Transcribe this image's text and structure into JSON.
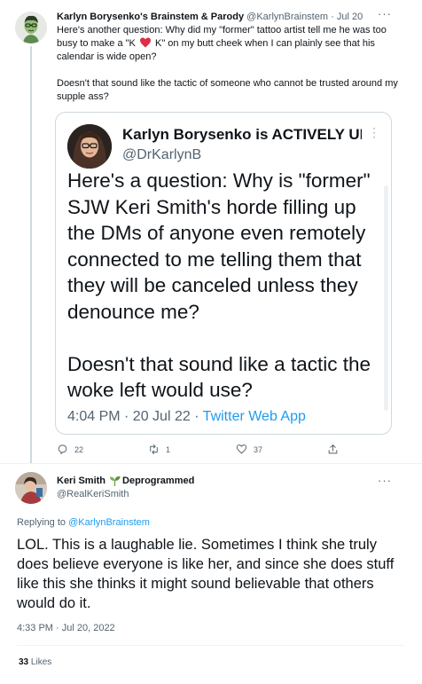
{
  "tweet": {
    "author_name": "Karlyn Borysenko's Brainstem & Parody",
    "author_handle": "@KarlynBrainstem",
    "separator": "·",
    "date": "Jul 20",
    "text_line1_before_heart": "Here's another question: Why did my \"former\" tattoo artist tell me he was too busy to make a \"K ",
    "text_line1_after_heart": " K\" on my butt cheek when I can plainly see that his calendar is wide open?",
    "text_paragraph2": "Doesn't that sound like the tactic of someone who cannot be trusted around my supple ass?",
    "heart_icon": "red-heart-emoji",
    "stats": {
      "replies": "22",
      "retweets": "1",
      "likes": "37"
    }
  },
  "quoted_tweet": {
    "author_name": "Karlyn Borysenko is ACTIVELY UN...",
    "author_handle": "@DrKarlynB",
    "paragraph1": "Here's a question: Why is \"former\" SJW Keri Smith's horde filling up the DMs of anyone even remotely connected to me telling them that they will be canceled unless they denounce me?",
    "paragraph2": "Doesn't that sound like a tactic the woke left would use?",
    "timestamp": "4:04 PM · 20 Jul 22 · ",
    "source": "Twitter Web App"
  },
  "reply": {
    "author_name": "Keri Smith",
    "author_name_suffix": "Deprogrammed",
    "sprout_icon": "seedling-icon",
    "author_handle": "@RealKeriSmith",
    "replying_to_label": "Replying to ",
    "replying_to_handle": "@KarlynBrainstem",
    "text": "LOL. This is a laughable lie. Sometimes I think she truly does believe everyone is like her, and since she does stuff like this she thinks it might sound believable that others would do it.",
    "timestamp": "4:33 PM · Jul 20, 2022",
    "likes_count": "33",
    "likes_label": "Likes"
  },
  "colors": {
    "text": "#0f1419",
    "secondary": "#536471",
    "link": "#1d9bf0",
    "border": "#cfd9de"
  }
}
